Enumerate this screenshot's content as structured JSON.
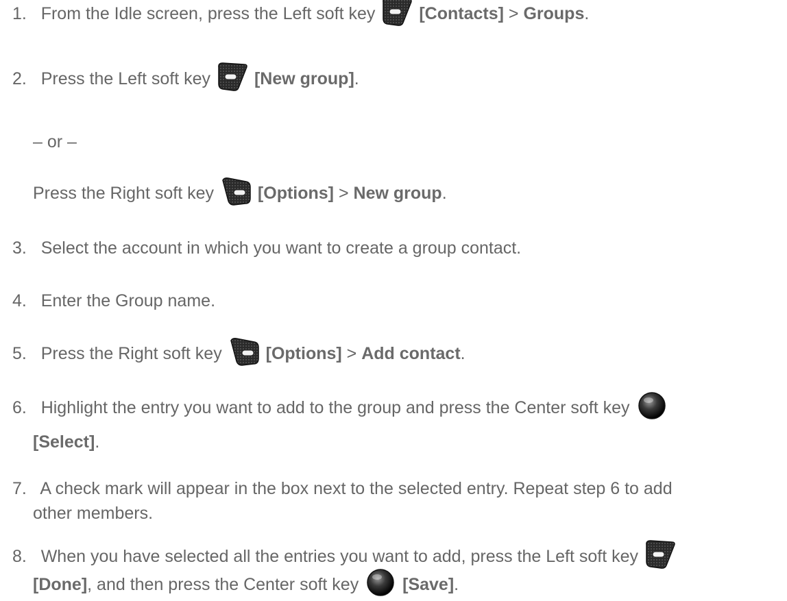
{
  "steps": [
    {
      "num": "1.",
      "text1": "From the Idle screen, press the Left soft key",
      "bold1": "[Contacts]",
      "sep": " > ",
      "bold2": "Groups",
      "end": "."
    },
    {
      "num": "2.",
      "text1": "Press the Left soft key",
      "bold1": "[New group]",
      "end": "."
    },
    {
      "or": "– or –"
    },
    {
      "text1": "Press the Right soft key",
      "bold1": "[Options]",
      "sep": " > ",
      "bold2": "New group",
      "end": "."
    },
    {
      "num": "3.",
      "text1": "Select the account in which you want to create a group contact."
    },
    {
      "num": "4.",
      "text1": "Enter the Group name."
    },
    {
      "num": "5.",
      "text1": "Press the Right soft key",
      "bold1": "[Options]",
      "sep": " > ",
      "bold2": "Add contact",
      "end": "."
    },
    {
      "num": "6.",
      "text1": "Highlight the entry you want to add to the group and press the Center soft key",
      "bold1": "[Select]",
      "end": "."
    },
    {
      "num": "7.",
      "text1": "A check mark will appear in the box next to the selected entry. Repeat step 6 to add",
      "text2": "other members."
    },
    {
      "num": "8.",
      "text1": "When you have selected all the entries you want to add, press the Left soft key",
      "bold1": "[Done]",
      "text2": ", and then press the Center soft key",
      "bold2": "[Save]",
      "end": "."
    }
  ],
  "icons": {
    "left": "left-soft-key-icon",
    "right": "right-soft-key-icon",
    "center": "center-soft-key-icon"
  }
}
